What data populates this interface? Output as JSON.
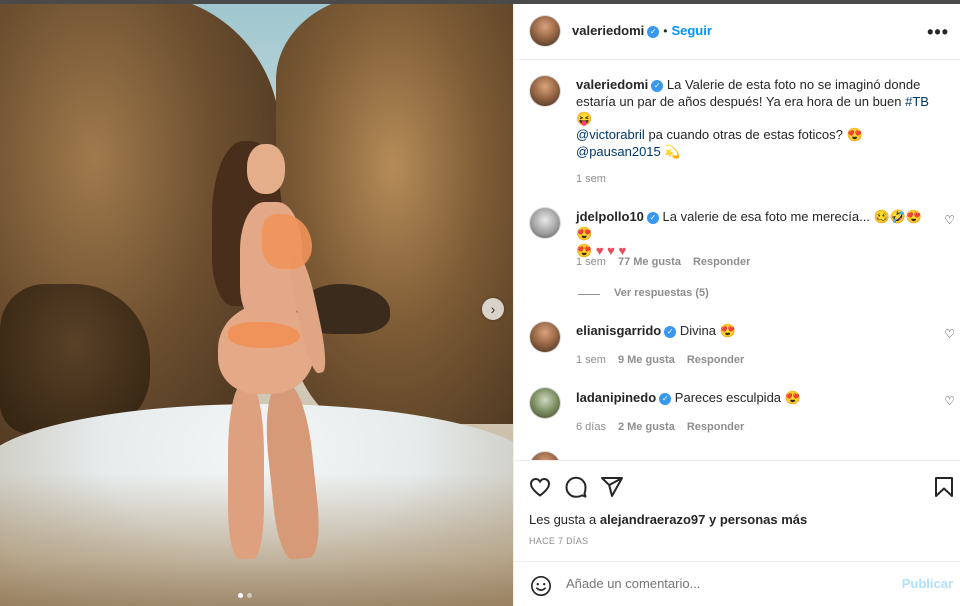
{
  "post": {
    "author": "valeriedomi",
    "follow_label": "Seguir",
    "separator": "•",
    "more_icon": "more-horizontal-icon"
  },
  "caption": {
    "author": "valeriedomi",
    "text_part1": "La Valerie de esta foto no se imaginó donde estaría un par de años después! Ya era hora de un buen",
    "hashtag": "#TB",
    "emoji1": "😝",
    "mention1": "@victorabril",
    "mid_text": " pa cuando otras de estas foticos? ",
    "emoji2": "😍",
    "mention2": "@pausan2015",
    "emoji3": "💫",
    "time": "1 sem"
  },
  "comments": [
    {
      "username": "jdelpollo10",
      "text": "La valerie de esa foto me merecía... ",
      "emojis": "🥴🤣😍😍",
      "emojis2": "😍",
      "hearts": "♥ ♥ ♥",
      "time": "1 sem",
      "likes": "77 Me gusta",
      "reply": "Responder",
      "view_replies": "Ver respuestas (5)"
    },
    {
      "username": "elianisgarrido",
      "text": "Divina ",
      "emojis": "😍",
      "time": "1 sem",
      "likes": "9 Me gusta",
      "reply": "Responder"
    },
    {
      "username": "ladanipinedo",
      "text": "Pareces esculpida ",
      "emojis": "😍",
      "time": "6 días",
      "likes": "2 Me gusta",
      "reply": "Responder"
    }
  ],
  "actions": {
    "like_icon": "heart-icon",
    "comment_icon": "comment-icon",
    "share_icon": "send-icon",
    "save_icon": "bookmark-icon",
    "likes_prefix": "Les gusta a",
    "likes_user": "alejandraerazo97",
    "likes_suffix": "y personas más",
    "date": "HACE 7 DÍAS"
  },
  "add_comment": {
    "placeholder": "Añade un comentario...",
    "publish_label": "Publicar",
    "emoji_icon": "smiley-icon"
  },
  "media": {
    "next_icon": "chevron-right-icon",
    "slides": 2,
    "active_slide": 1
  },
  "colors": {
    "accent": "#0095f6",
    "verified": "#3897f0",
    "publish_disabled": "#b2dffc",
    "muted": "#8e8e8e"
  }
}
